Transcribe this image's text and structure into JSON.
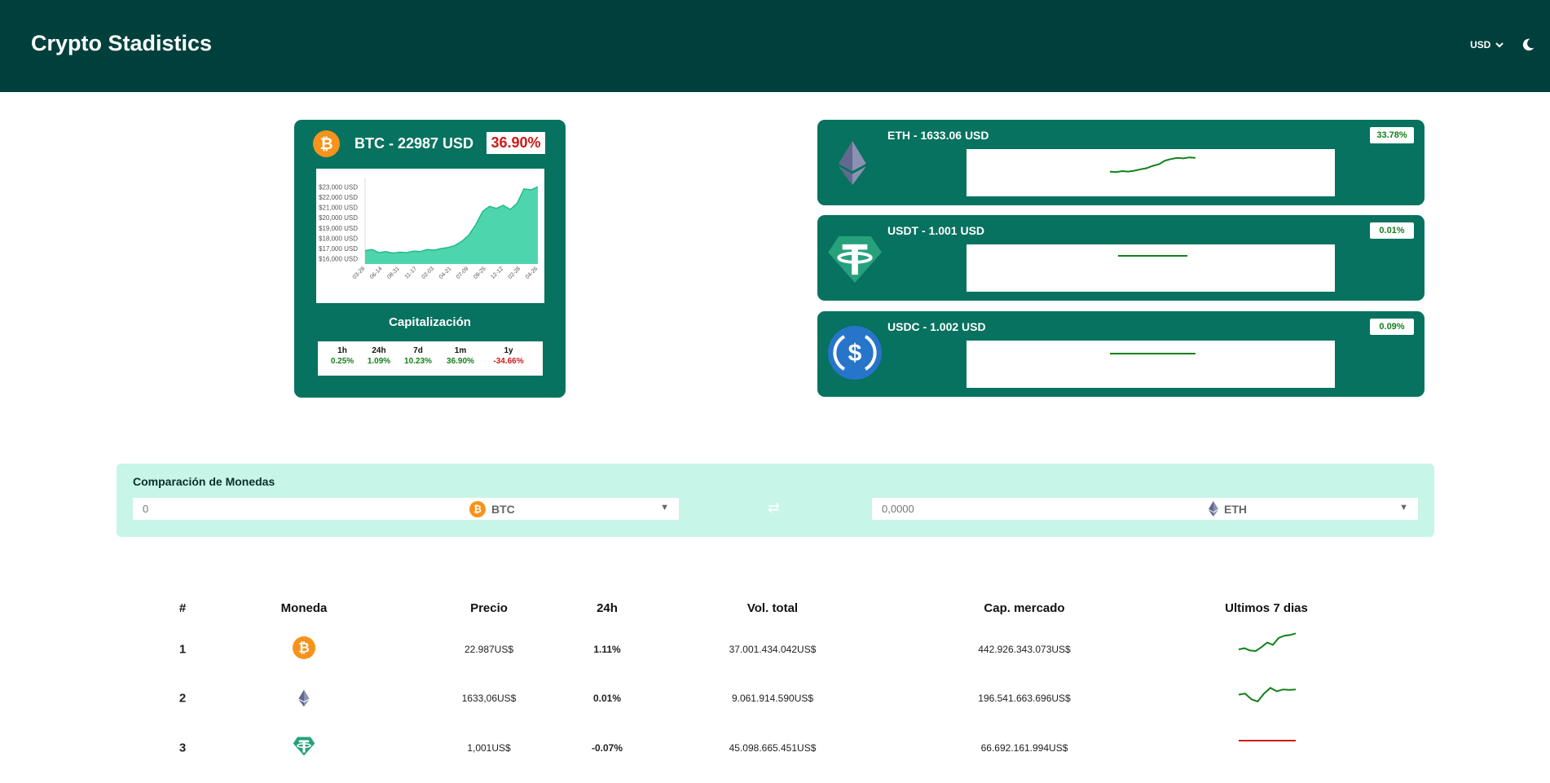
{
  "header": {
    "title": "Crypto Stadistics",
    "currency": "USD"
  },
  "featured": {
    "title": "BTC - 22987 USD",
    "change": "36.90%",
    "icon": "bitcoin-icon",
    "cap_label": "Capitalización",
    "changes": [
      {
        "label": "1h",
        "value": "0.25%",
        "trend": "up"
      },
      {
        "label": "24h",
        "value": "1.09%",
        "trend": "up"
      },
      {
        "label": "7d",
        "value": "10.23%",
        "trend": "up"
      },
      {
        "label": "1m",
        "value": "36.90%",
        "trend": "up"
      },
      {
        "label": "1y",
        "value": "-34.66%",
        "trend": "down"
      }
    ]
  },
  "chart_data": {
    "type": "area",
    "title": "",
    "xlabel": "",
    "ylabel": "",
    "x": [
      "03-28",
      "06-14",
      "08-31",
      "11-17",
      "02-03",
      "04-21",
      "07-09",
      "09-25",
      "12-12",
      "02-28",
      "04-26"
    ],
    "y_ticks": [
      "$16,000 USD",
      "$17,000 USD",
      "$18,000 USD",
      "$19,000 USD",
      "$20,000 USD",
      "$21,000 USD",
      "$22,000 USD",
      "$23,000 USD"
    ],
    "ylim": [
      15500,
      23500
    ],
    "values": [
      16800,
      16900,
      16600,
      16700,
      16550,
      16650,
      16600,
      16750,
      16700,
      16900,
      16850,
      17000,
      17100,
      17300,
      17700,
      18300,
      19300,
      20600,
      21100,
      20900,
      21200,
      20800,
      21400,
      22800,
      22700,
      23000
    ],
    "grid": false,
    "legend": "none",
    "color": "#2ecfa0"
  },
  "coins": [
    {
      "title": "ETH - 1633.06 USD",
      "badge": "33.78%",
      "icon": "ethereum-icon",
      "spark": [
        0.3,
        0.28,
        0.32,
        0.3,
        0.34,
        0.4,
        0.45,
        0.55,
        0.62,
        0.78,
        0.85,
        0.9,
        0.88,
        0.92,
        0.9
      ]
    },
    {
      "title": "USDT - 1.001 USD",
      "badge": "0.01%",
      "icon": "tether-icon",
      "spark": [
        0.5,
        0.5
      ]
    },
    {
      "title": "USDC - 1.002 USD",
      "badge": "0.09%",
      "icon": "usdc-icon",
      "spark": [
        0.5,
        0.5
      ]
    }
  ],
  "compare": {
    "title": "Comparación de Monedas",
    "left_value": "0",
    "left_coin": "BTC",
    "right_value": "0,0000",
    "right_coin": "ETH"
  },
  "table": {
    "headers": [
      "#",
      "Moneda",
      "Precio",
      "24h",
      "Vol. total",
      "Cap. mercado",
      "Ultimos 7 dias"
    ],
    "rows": [
      {
        "rank": "1",
        "icon": "bitcoin-icon",
        "price": "22.987US$",
        "change": "1.11%",
        "trend": "up",
        "volume": "37.001.434.042US$",
        "cap": "442.926.343.073US$",
        "spark": [
          0.25,
          0.3,
          0.2,
          0.18,
          0.35,
          0.55,
          0.45,
          0.75,
          0.85,
          0.88,
          0.95
        ]
      },
      {
        "rank": "2",
        "icon": "ethereum-icon",
        "price": "1633,06US$",
        "change": "0.01%",
        "trend": "up",
        "volume": "9.061.914.590US$",
        "cap": "196.541.663.696US$",
        "spark": [
          0.55,
          0.6,
          0.35,
          0.25,
          0.6,
          0.85,
          0.7,
          0.78,
          0.76,
          0.78
        ]
      },
      {
        "rank": "3",
        "icon": "tether-icon",
        "price": "1,001US$",
        "change": "-0.07%",
        "trend": "down",
        "volume": "45.098.665.451US$",
        "cap": "66.692.161.994US$",
        "spark": [
          0.5,
          0.5
        ]
      }
    ]
  },
  "colors": {
    "header_bg": "#00403c",
    "card_bg": "#06725f",
    "compare_bg": "#c7f5e8",
    "positive": "#12801b",
    "negative": "#d01818",
    "accent_area": "#2ecfa0"
  }
}
